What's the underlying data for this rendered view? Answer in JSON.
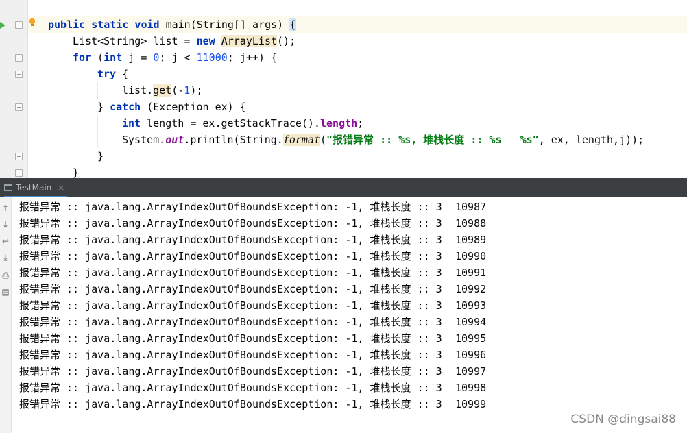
{
  "editor": {
    "lines": [
      {
        "tokens": [
          {
            "t": "public static void ",
            "c": "kw"
          },
          {
            "t": "main(String[] args) ",
            "c": ""
          },
          {
            "t": "{",
            "c": "brace-hl"
          }
        ]
      },
      {
        "tokens": [
          {
            "t": "List<String> list = ",
            "c": ""
          },
          {
            "t": "new ",
            "c": "kw"
          },
          {
            "t": "ArrayList",
            "c": "hl"
          },
          {
            "t": "();",
            "c": ""
          }
        ]
      },
      {
        "tokens": [
          {
            "t": "for ",
            "c": "kw"
          },
          {
            "t": "(",
            "c": ""
          },
          {
            "t": "int ",
            "c": "kw"
          },
          {
            "t": "j = ",
            "c": ""
          },
          {
            "t": "0",
            "c": "num"
          },
          {
            "t": "; j < ",
            "c": ""
          },
          {
            "t": "11000",
            "c": "num"
          },
          {
            "t": "; j++) {",
            "c": ""
          }
        ]
      },
      {
        "tokens": [
          {
            "t": "try ",
            "c": "kw"
          },
          {
            "t": "{",
            "c": ""
          }
        ]
      },
      {
        "tokens": [
          {
            "t": "list.",
            "c": ""
          },
          {
            "t": "get",
            "c": "hl"
          },
          {
            "t": "(-",
            "c": ""
          },
          {
            "t": "1",
            "c": "num"
          },
          {
            "t": ");",
            "c": ""
          }
        ]
      },
      {
        "tokens": [
          {
            "t": "} ",
            "c": ""
          },
          {
            "t": "catch ",
            "c": "kw"
          },
          {
            "t": "(Exception ex) {",
            "c": ""
          }
        ]
      },
      {
        "tokens": [
          {
            "t": "int ",
            "c": "kw"
          },
          {
            "t": "length = ex.getStackTrace().",
            "c": ""
          },
          {
            "t": "length",
            "c": "fld"
          },
          {
            "t": ";",
            "c": ""
          }
        ]
      },
      {
        "tokens": [
          {
            "t": "System.",
            "c": ""
          },
          {
            "t": "out",
            "c": "fldi"
          },
          {
            "t": ".println(String.",
            "c": ""
          },
          {
            "t": "format",
            "c": "hl ital"
          },
          {
            "t": "(",
            "c": ""
          },
          {
            "t": "\"报错异常 :: %s, 堆栈长度 :: %s   %s\"",
            "c": "str"
          },
          {
            "t": ", ex, length,j));",
            "c": ""
          }
        ]
      },
      {
        "tokens": [
          {
            "t": "}",
            "c": ""
          }
        ]
      },
      {
        "tokens": [
          {
            "t": "}",
            "c": ""
          }
        ]
      }
    ]
  },
  "run_panel": {
    "tab_label": "TestMain",
    "close_glyph": "×"
  },
  "console": {
    "toolbar_icons": [
      "up-arrow-icon",
      "down-arrow-icon",
      "soft-wrap-icon",
      "scroll-to-end-icon",
      "print-icon",
      "trash-icon"
    ],
    "lines": [
      {
        "msg": "报错异常 :: java.lang.ArrayIndexOutOfBoundsException: -1, 堆栈长度 :: 3",
        "num": "10987"
      },
      {
        "msg": "报错异常 :: java.lang.ArrayIndexOutOfBoundsException: -1, 堆栈长度 :: 3",
        "num": "10988"
      },
      {
        "msg": "报错异常 :: java.lang.ArrayIndexOutOfBoundsException: -1, 堆栈长度 :: 3",
        "num": "10989"
      },
      {
        "msg": "报错异常 :: java.lang.ArrayIndexOutOfBoundsException: -1, 堆栈长度 :: 3",
        "num": "10990"
      },
      {
        "msg": "报错异常 :: java.lang.ArrayIndexOutOfBoundsException: -1, 堆栈长度 :: 3",
        "num": "10991"
      },
      {
        "msg": "报错异常 :: java.lang.ArrayIndexOutOfBoundsException: -1, 堆栈长度 :: 3",
        "num": "10992"
      },
      {
        "msg": "报错异常 :: java.lang.ArrayIndexOutOfBoundsException: -1, 堆栈长度 :: 3",
        "num": "10993"
      },
      {
        "msg": "报错异常 :: java.lang.ArrayIndexOutOfBoundsException: -1, 堆栈长度 :: 3",
        "num": "10994"
      },
      {
        "msg": "报错异常 :: java.lang.ArrayIndexOutOfBoundsException: -1, 堆栈长度 :: 3",
        "num": "10995"
      },
      {
        "msg": "报错异常 :: java.lang.ArrayIndexOutOfBoundsException: -1, 堆栈长度 :: 3",
        "num": "10996"
      },
      {
        "msg": "报错异常 :: java.lang.ArrayIndexOutOfBoundsException: -1, 堆栈长度 :: 3",
        "num": "10997"
      },
      {
        "msg": "报错异常 :: java.lang.ArrayIndexOutOfBoundsException: -1, 堆栈长度 :: 3",
        "num": "10998"
      },
      {
        "msg": "报错异常 :: java.lang.ArrayIndexOutOfBoundsException: -1, 堆栈长度 :: 3",
        "num": "10999"
      }
    ]
  },
  "watermark": "CSDN @dingsai88",
  "colors": {
    "keyword": "#0033b3",
    "number": "#1750eb",
    "string": "#067d17",
    "field": "#871094",
    "run_panel_bg": "#3c3f41",
    "run_icon": "#4caf50"
  }
}
